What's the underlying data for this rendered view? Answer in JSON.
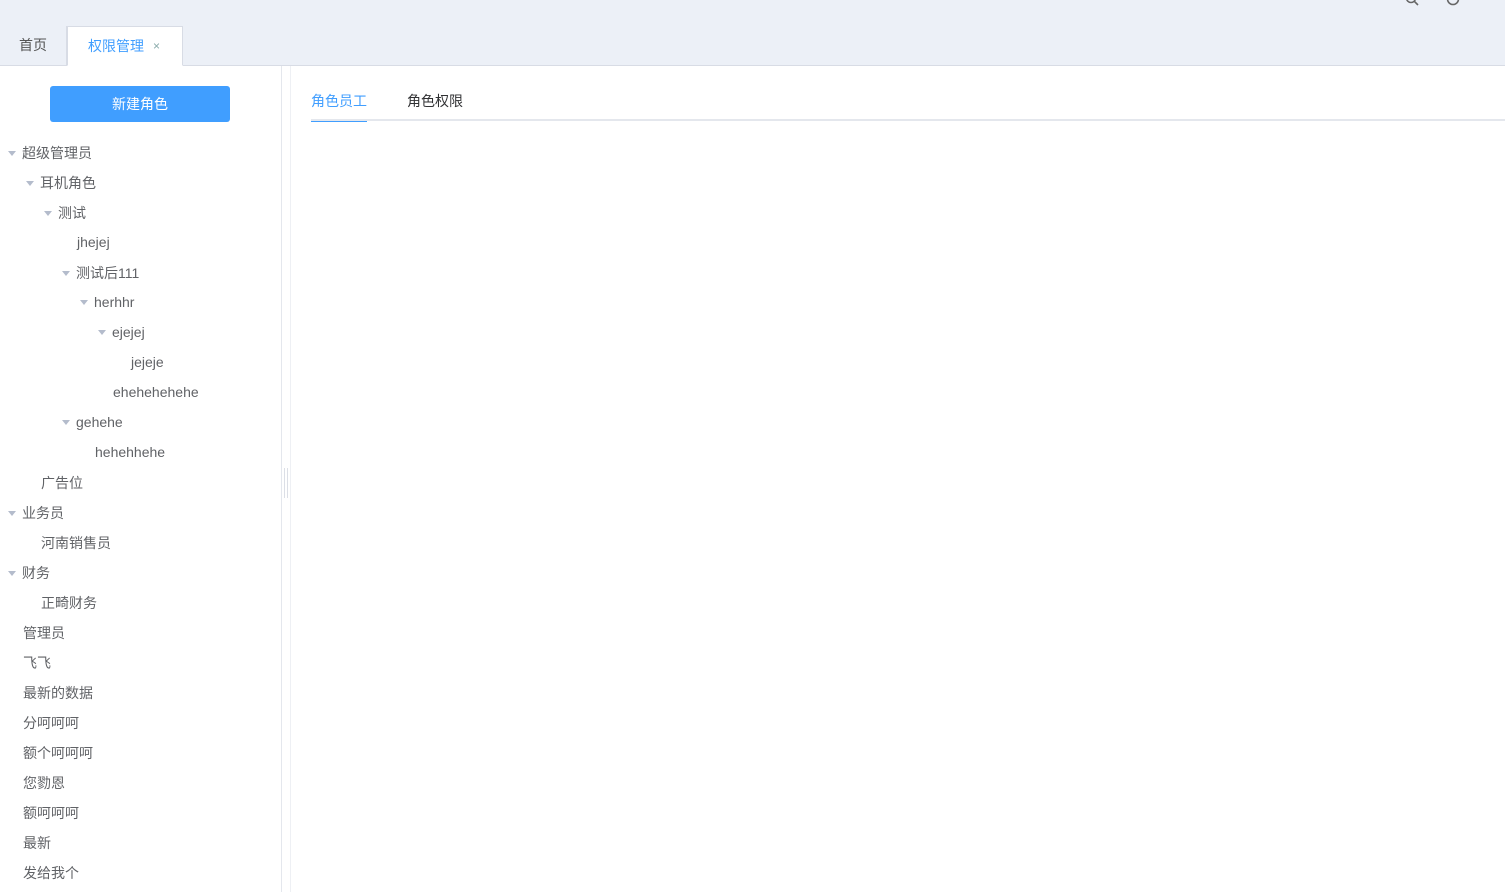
{
  "colors": {
    "accent": "#409eff",
    "header_bg": "#ecf0f7",
    "text": "#606266"
  },
  "header": {
    "menu_icon": "hamburger-icon",
    "right_icons": [
      "search-icon",
      "clock-icon",
      "fullscreen-icon"
    ]
  },
  "tabs": [
    {
      "label": "首页",
      "active": false
    },
    {
      "label": "权限管理",
      "active": true,
      "close": "×"
    }
  ],
  "sidebar": {
    "new_role_label": "新建角色",
    "tree": [
      {
        "label": "超级管理员",
        "expanded": true
      },
      {
        "label": "耳机角色",
        "expanded": true
      },
      {
        "label": "测试",
        "expanded": true
      },
      {
        "label": "jhejej",
        "expanded": false
      },
      {
        "label": "测试后111",
        "expanded": true
      },
      {
        "label": "herhhr",
        "expanded": true
      },
      {
        "label": "ejejej",
        "expanded": true
      },
      {
        "label": "jejeje",
        "expanded": false
      },
      {
        "label": "ehehehehehe",
        "expanded": false
      },
      {
        "label": "gehehe",
        "expanded": true
      },
      {
        "label": "hehehhehe",
        "expanded": false
      },
      {
        "label": "广告位",
        "expanded": false
      },
      {
        "label": "业务员",
        "expanded": true
      },
      {
        "label": "河南销售员",
        "expanded": false
      },
      {
        "label": "财务",
        "expanded": true
      },
      {
        "label": "正畸财务",
        "expanded": false
      },
      {
        "label": "管理员",
        "expanded": false
      },
      {
        "label": "飞飞",
        "expanded": false
      },
      {
        "label": "最新的数据",
        "expanded": false
      },
      {
        "label": "分呵呵呵",
        "expanded": false
      },
      {
        "label": "额个呵呵呵",
        "expanded": false
      },
      {
        "label": "您勠恩",
        "expanded": false
      },
      {
        "label": "额呵呵呵",
        "expanded": false
      },
      {
        "label": "最新",
        "expanded": false
      },
      {
        "label": "发给我个",
        "expanded": false
      }
    ]
  },
  "main": {
    "tabs": [
      {
        "label": "角色员工",
        "active": true
      },
      {
        "label": "角色权限",
        "active": false
      }
    ]
  }
}
